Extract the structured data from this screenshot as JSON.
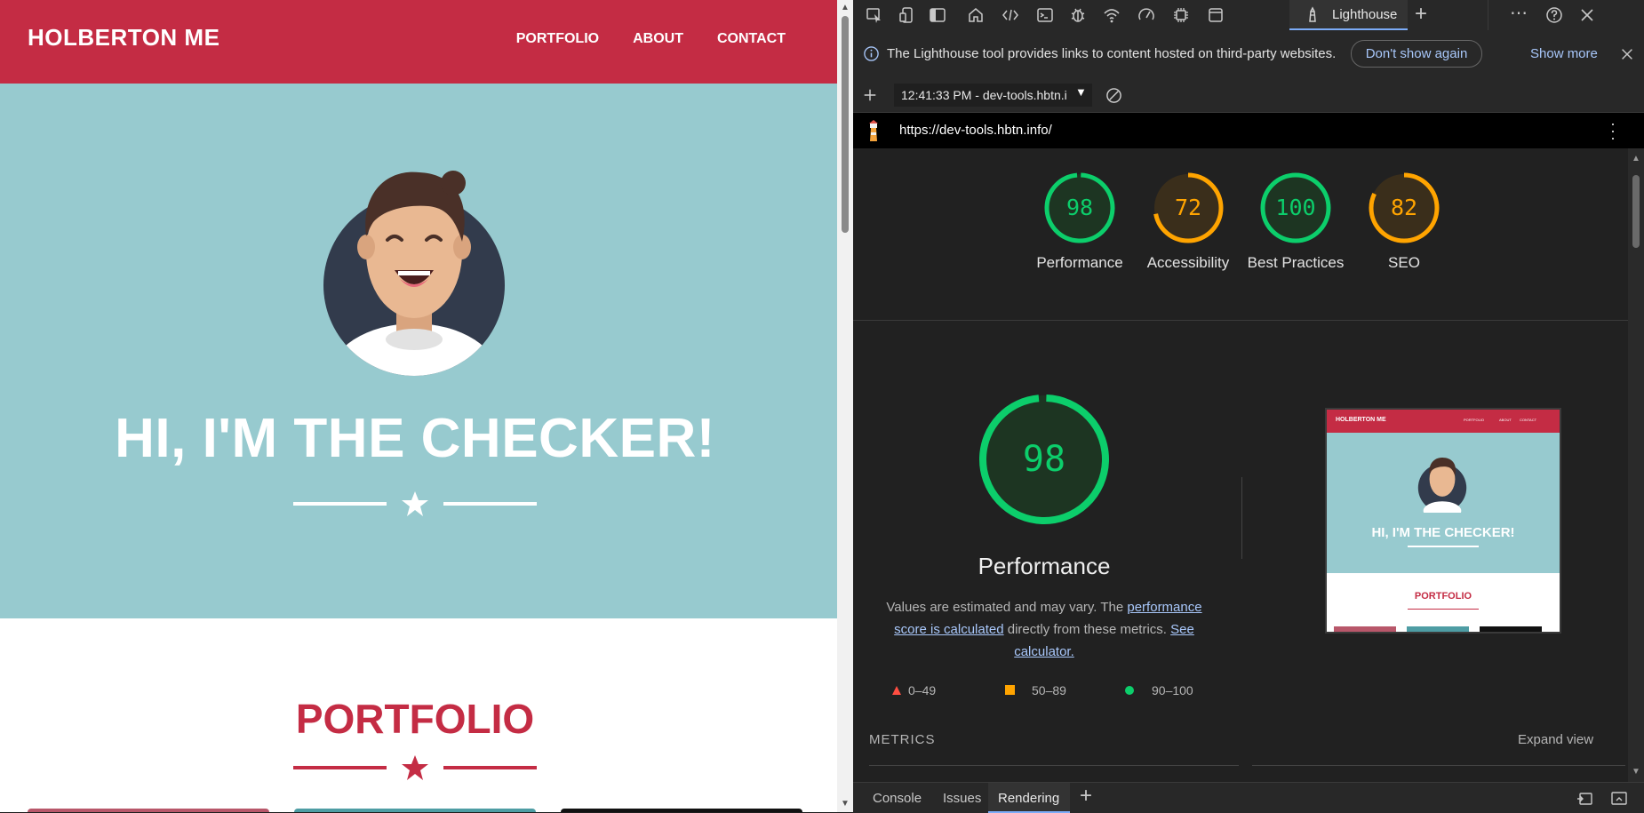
{
  "website": {
    "brand": "HOLBERTON ME",
    "nav": [
      "PORTFOLIO",
      "ABOUT",
      "CONTACT"
    ],
    "hero_title": "HI, I'M THE CHECKER!",
    "portfolio_title": "PORTFOLIO",
    "colors": {
      "header": "#c42c44",
      "hero": "#97cacf"
    }
  },
  "devtools": {
    "active_tab": "Lighthouse",
    "infobar": {
      "message": "The Lighthouse tool provides links to content hosted on third-party websites.",
      "dont_show": "Don't show again",
      "show_more": "Show more"
    },
    "report_selector": "12:41:33 PM - dev-tools.hbtn.i",
    "url": "https://dev-tools.hbtn.info/",
    "scores": [
      {
        "label": "Performance",
        "value": 98,
        "status": "pass"
      },
      {
        "label": "Accessibility",
        "value": 72,
        "status": "average"
      },
      {
        "label": "Best Practices",
        "value": 100,
        "status": "pass"
      },
      {
        "label": "SEO",
        "value": 82,
        "status": "average"
      }
    ],
    "performance": {
      "score": 98,
      "title": "Performance",
      "desc_prefix": "Values are estimated and may vary. The ",
      "desc_link1": "performance score is calculated",
      "desc_mid": " directly from these metrics. ",
      "desc_link2": "See calculator."
    },
    "legend": [
      "0–49",
      "50–89",
      "90–100"
    ],
    "metrics_label": "METRICS",
    "expand_view": "Expand view",
    "thumbnail": {
      "brand": "HOLBERTON ME",
      "nav": [
        "PORTFOLIO",
        "ABOUT",
        "CONTACT"
      ],
      "hero_title": "HI, I'M THE CHECKER!",
      "section_title": "PORTFOLIO"
    },
    "drawer_tabs": [
      "Console",
      "Issues",
      "Rendering"
    ]
  }
}
